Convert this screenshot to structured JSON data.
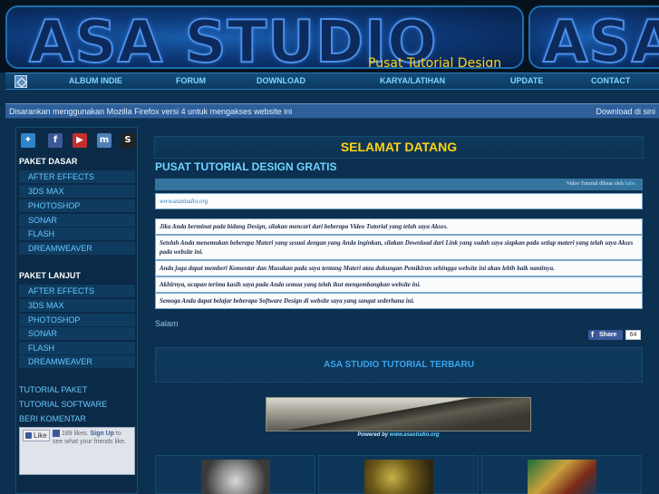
{
  "banner": {
    "logo": "ASA STUDIO",
    "logo_right": "ASA",
    "tagline": "Pusat Tutorial Design Gratis"
  },
  "nav": {
    "items": [
      "ALBUM INDIE",
      "FORUM",
      "DOWNLOAD",
      "KARYA/LATIHAN",
      "UPDATE",
      "CONTACT"
    ]
  },
  "notice": {
    "text": "Disarankan menggunakan Mozilla Firefox versi 4 untuk mengakses website ini",
    "right": "Download di sini"
  },
  "sidebar": {
    "social_icons": [
      "twitter-icon",
      "facebook-icon",
      "youtube-icon",
      "myspace-icon",
      "scribd-icon"
    ],
    "social_glyphs": [
      "✦",
      "f",
      "▶",
      "m",
      "S"
    ],
    "section1": "PAKET DASAR",
    "section1_items": [
      "AFTER EFFECTS",
      "3DS MAX",
      "PHOTOSHOP",
      "SONAR",
      "FLASH",
      "DREAMWEAVER"
    ],
    "section2": "PAKET LANJUT",
    "section2_items": [
      "AFTER EFFECTS",
      "3DS MAX",
      "PHOTOSHOP",
      "SONAR",
      "FLASH",
      "DREAMWEAVER"
    ],
    "links": [
      "TUTORIAL PAKET",
      "TUTORIAL SOFTWARE",
      "BERI KOMENTAR"
    ],
    "fb_like": "Like",
    "fb_count": "189 likes.",
    "fb_signup": "Sign Up",
    "fb_rest": "to see what your friends like."
  },
  "main": {
    "welcome": "SELAMAT DATANG",
    "title": "PUSAT TUTORIAL DESIGN GRATIS",
    "video_prefix": "Video Tutorial dibuat oleh",
    "video_link": "habo",
    "site": "www.asastudio.org",
    "paragraphs": [
      "Jika Anda berminat pada bidang Design, silakan mencari dari beberapa Video Tutorial yang telah saya Akses.",
      "Setelah Anda menemukan beberapa Materi yang sesuai dengan yang Anda inginkan, silakan Download dari Link yang sudah saya siapkan pada setiap materi yang telah saya Akses pada website ini.",
      "Anda juga dapat memberi Komentar dan Masukan pada saya tentang Materi atau dukungan Pemikiran sehingga website ini akan lebih baik nantinya.",
      "Akhirnya, ucapan terima kasih saya pada Anda semua yang telah ikut mengembangkan website ini.",
      "Semoga Anda dapat belajar beberapa Software Design di website saya yang sangat sederhana ini."
    ],
    "salam": "Salam",
    "share": "Share",
    "share_count": "64",
    "latest_heading": "ASA STUDIO TUTORIAL TERBARU",
    "banner_caption_prefix": "Powered by",
    "banner_caption_site": "www.asastudio.org"
  },
  "colors": {
    "background": "#0b3050",
    "accent_yellow": "#ffd20e",
    "link_blue": "#66c8ff"
  }
}
